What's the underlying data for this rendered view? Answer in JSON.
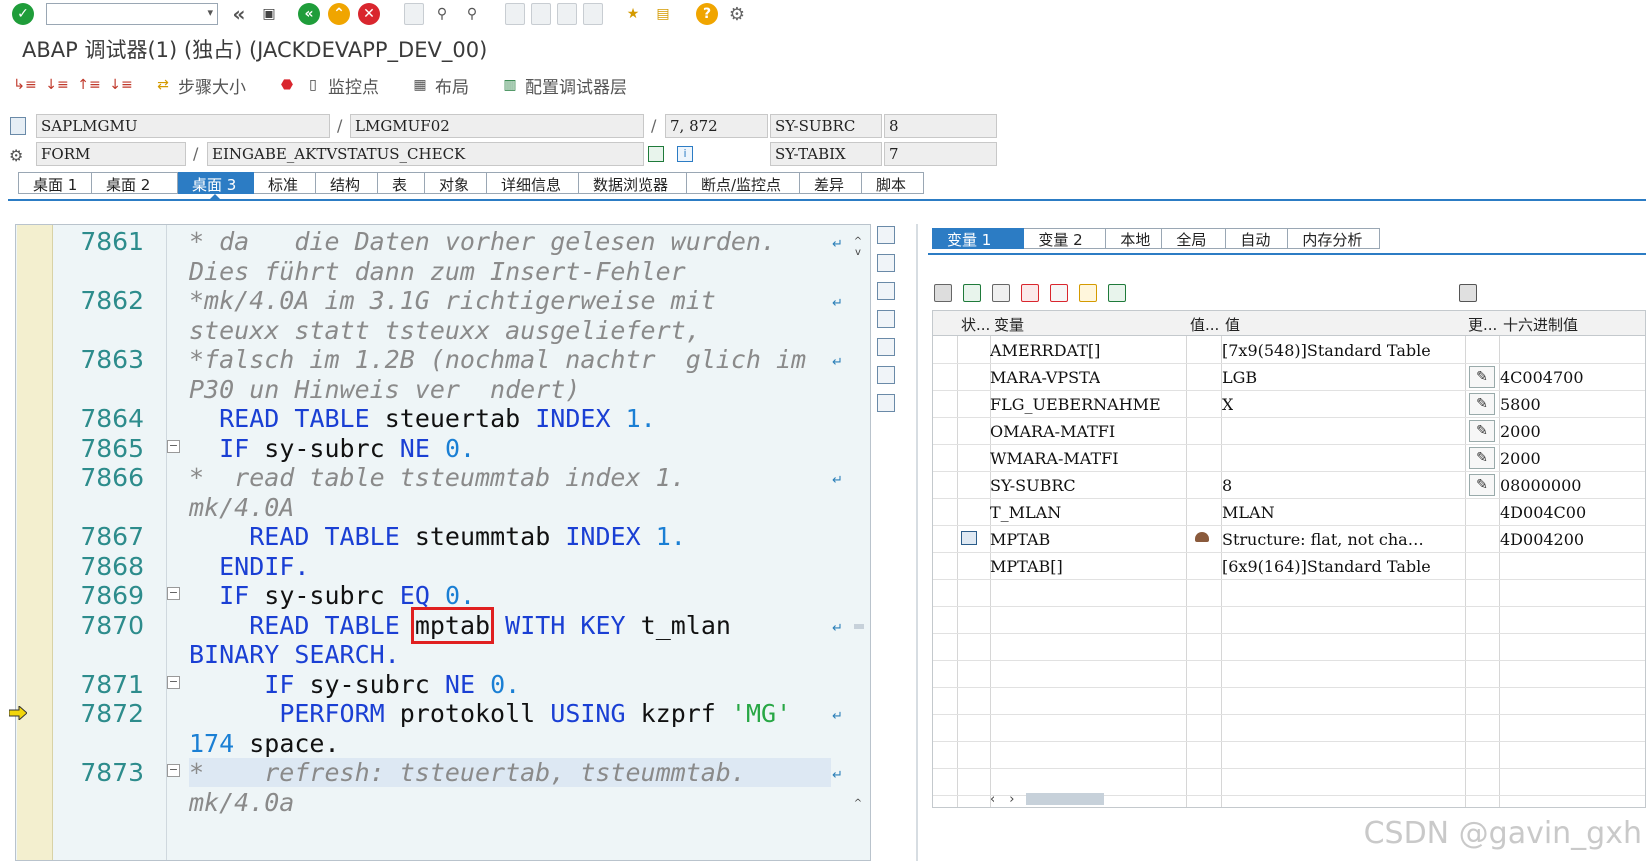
{
  "system_toolbar": {
    "command_field_value": "",
    "icons": [
      "enter-icon",
      "back-icon",
      "exit-icon",
      "cancel-icon",
      "print-icon",
      "find-icon",
      "find-next-icon",
      "first-page-icon",
      "prev-page-icon",
      "next-page-icon",
      "last-page-icon",
      "new-session-icon",
      "shortcut-icon",
      "help-icon",
      "settings-icon"
    ]
  },
  "window_title": "ABAP 调试器(1)  (独占) (JACKDEVAPP_DEV_00)",
  "app_toolbar": {
    "step_size": "步骤大小",
    "watchpoint": "监控点",
    "layout": "布局",
    "config_debugger_layer": "配置调试器层"
  },
  "program_info": {
    "program": "SAPLMGMU",
    "include": "LMGMUF02",
    "line": "7, 872",
    "subrc_label": "SY-SUBRC",
    "subrc_value": "8",
    "event_type": "FORM",
    "event_name": "EINGABE_AKTVSTATUS_CHECK",
    "tabix_label": "SY-TABIX",
    "tabix_value": "7"
  },
  "desktop_tabs": [
    "桌面 1",
    "桌面 2",
    "桌面 3",
    "标准",
    "结构",
    "表",
    "对象",
    "详细信息",
    "数据浏览器",
    "断点/监控点",
    "差异",
    "脚本"
  ],
  "active_desktop_tab": "桌面 3",
  "source_code": {
    "line_numbers": [
      "7861",
      "7862",
      "7863",
      "7864",
      "7865",
      "7866",
      "7867",
      "7868",
      "7869",
      "7870",
      "7871",
      "7872",
      "7873"
    ],
    "lines": {
      "l7861a": "* da   die Daten vorher gelesen wurden.",
      "l7861b": "Dies führt dann zum Insert-Fehler",
      "l7862a": "*mk/4.0A im 3.1G richtigerweise mit",
      "l7862b": "steuxx statt tsteuxx ausgeliefert,",
      "l7863a": "*falsch im 1.2B (nochmal nachtr  glich im",
      "l7863b": "P30 un Hinweis ver  ndert)",
      "l7866a": "*  read table tsteummtab index 1.",
      "l7866b": "mk/4.0A",
      "l7873a": "*    refresh: tsteuertab, tsteummtab.",
      "l7873b": "mk/4.0a"
    },
    "kw": {
      "read": "READ",
      "table": "TABLE",
      "index": "INDEX",
      "if": "IF",
      "ne": "NE",
      "eq": "EQ",
      "endif": "ENDIF.",
      "with_key": "WITH KEY",
      "binary_search": "BINARY SEARCH.",
      "perform": "PERFORM",
      "using": "USING"
    },
    "ids": {
      "steuertab": "steuertab",
      "steummtab": "steummtab",
      "sy_subrc": "sy-subrc",
      "mptab": "mptab",
      "t_mlan": "t_mlan",
      "protokoll": "protokoll",
      "kzprf": "kzprf",
      "space": "space."
    },
    "nums": {
      "one_dot": "1.",
      "zero_dot": "0.",
      "n174": "174"
    },
    "strings": {
      "mg": "'MG'"
    },
    "highlighted_identifier": "mptab",
    "current_line": "7872"
  },
  "variable_tabs": [
    "变量 1",
    "变量 2",
    "本地",
    "全局",
    "自动",
    "内存分析"
  ],
  "active_variable_tab": "变量 1",
  "variable_table": {
    "headers": {
      "status": "状...",
      "variable": "变量",
      "value_type": "值...",
      "value": "值",
      "change": "更...",
      "hex": "十六进制值"
    },
    "rows": [
      {
        "variable": "AMERRDAT[]",
        "value": "[7x9(548)]Standard Table",
        "hex": ""
      },
      {
        "variable": "MARA-VPSTA",
        "value": "LGB",
        "hex": "4C004700"
      },
      {
        "variable": "FLG_UEBERNAHME",
        "value": "X",
        "hex": "5800"
      },
      {
        "variable": "OMARA-MATFI",
        "value": "",
        "hex": "2000"
      },
      {
        "variable": "WMARA-MATFI",
        "value": "",
        "hex": "2000"
      },
      {
        "variable": "SY-SUBRC",
        "value": "8",
        "hex": "08000000"
      },
      {
        "variable": "T_MLAN",
        "value": "MLAN",
        "hex": "4D004C00"
      },
      {
        "variable": "MPTAB",
        "value": "Structure: flat, not cha…",
        "hex": "4D004200"
      },
      {
        "variable": "MPTAB[]",
        "value": "[6x9(164)]Standard Table",
        "hex": ""
      }
    ]
  },
  "watermark": "CSDN @gavin_gxh"
}
